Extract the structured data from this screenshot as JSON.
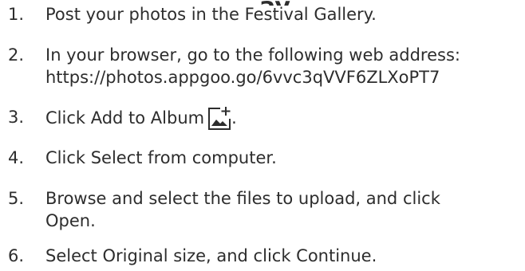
{
  "steps": [
    {
      "number": "1.",
      "lines": [
        "Post your photos in the Festival Gallery."
      ]
    },
    {
      "number": "2.",
      "lines": [
        "In your browser, go to the following web address:",
        "https://photos.appgoo.go/6vvc3qVVF6ZLXoPT7"
      ]
    },
    {
      "number": "3.",
      "text_before_icon": "Click Add to Album",
      "icon": "add-to-album-icon",
      "text_after_icon": "."
    },
    {
      "number": "4.",
      "lines": [
        "Click Select from computer."
      ]
    },
    {
      "number": "5.",
      "lines": [
        "Browse and select the files to upload, and click",
        "Open."
      ]
    },
    {
      "number": "6.",
      "lines": [
        "Select Original size, and click Continue."
      ]
    }
  ],
  "colors": {
    "text": "#2d2d2d",
    "background": "#ffffff"
  }
}
